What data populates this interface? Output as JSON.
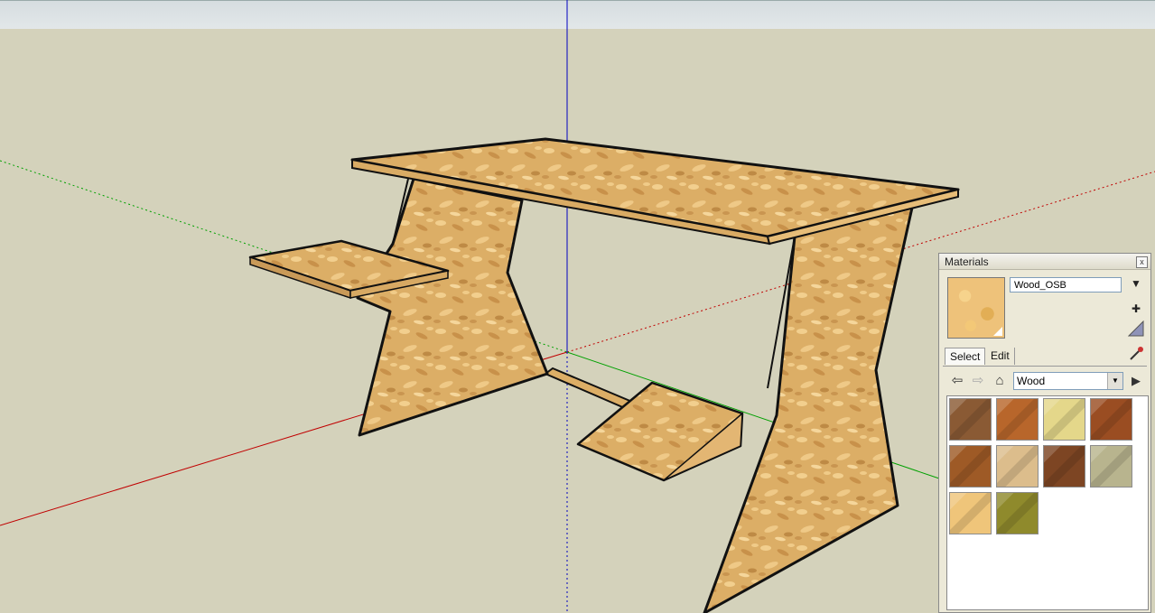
{
  "materials_panel": {
    "title": "Materials",
    "close_label": "x",
    "current_material": "Wood_OSB",
    "tabs": [
      {
        "label": "Select"
      },
      {
        "label": "Edit"
      }
    ],
    "collection": "Wood",
    "swatches": [
      {
        "name": "wood-swatch-1",
        "color": "#8a5a34"
      },
      {
        "name": "wood-swatch-2",
        "color": "#b8662b"
      },
      {
        "name": "wood-swatch-3",
        "color": "#e4d78a"
      },
      {
        "name": "wood-swatch-4",
        "color": "#9a4d22"
      },
      {
        "name": "wood-swatch-5",
        "color": "#9e5a26"
      },
      {
        "name": "wood-swatch-6",
        "color": "#dcbd8c"
      },
      {
        "name": "wood-swatch-7",
        "color": "#7d4523"
      },
      {
        "name": "wood-swatch-8",
        "color": "#b8b48e"
      },
      {
        "name": "wood-swatch-9",
        "color": "#efc57a"
      },
      {
        "name": "wood-swatch-10",
        "color": "#8f8a2c"
      }
    ]
  },
  "colors": {
    "background": "#d4d2bb",
    "osb": "#dcae66",
    "outline": "#111111",
    "axis_red": "#c00000",
    "axis_green": "#00a000",
    "axis_blue": "#0000c0"
  }
}
